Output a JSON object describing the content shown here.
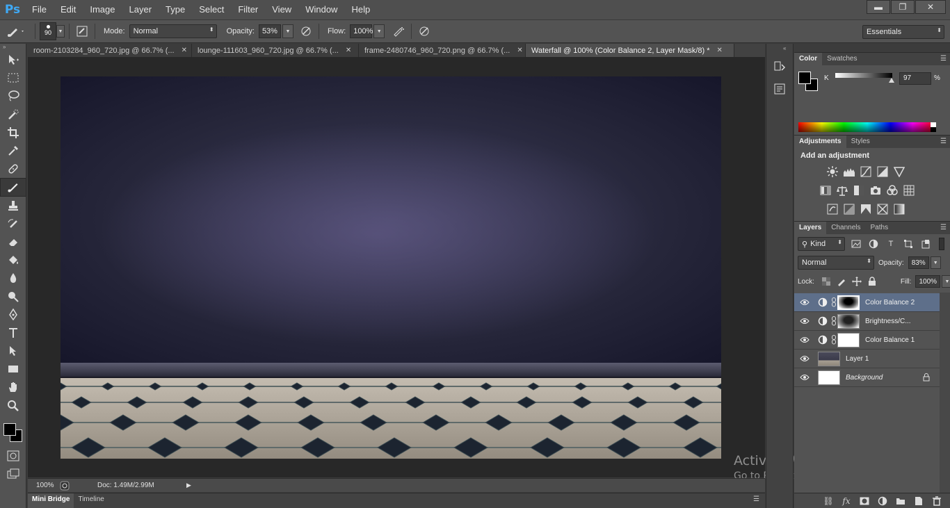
{
  "app": {
    "logo": "Ps"
  },
  "menu": [
    "File",
    "Edit",
    "Image",
    "Layer",
    "Type",
    "Select",
    "Filter",
    "View",
    "Window",
    "Help"
  ],
  "window_controls": {
    "minimize": "▬",
    "restore": "❐",
    "close": "✕"
  },
  "options": {
    "brush_size": "90",
    "mode_label": "Mode:",
    "mode_value": "Normal",
    "opacity_label": "Opacity:",
    "opacity_value": "53%",
    "flow_label": "Flow:",
    "flow_value": "100%",
    "workspace": "Essentials"
  },
  "tabs": [
    {
      "label": "room-2103284_960_720.jpg @ 66.7% (...",
      "active": false
    },
    {
      "label": "lounge-111603_960_720.jpg @ 66.7% (...",
      "active": false
    },
    {
      "label": "frame-2480746_960_720.png @ 66.7% (...",
      "active": false
    },
    {
      "label": "Waterfall @ 100% (Color Balance 2, Layer Mask/8) *",
      "active": true
    }
  ],
  "status": {
    "zoom": "100%",
    "doc": "Doc: 1.49M/2.99M"
  },
  "bottom_tabs": [
    "Mini Bridge",
    "Timeline"
  ],
  "watermark": {
    "line1": "Activate Windows",
    "line2": "Go to PC settings to activate Windows."
  },
  "color_panel": {
    "tabs": [
      "Color",
      "Swatches"
    ],
    "channel_label": "K",
    "channel_value": "97",
    "percent": "%",
    "k_level": 0.97
  },
  "adjustments_panel": {
    "tabs": [
      "Adjustments",
      "Styles"
    ],
    "title": "Add an adjustment"
  },
  "layers_panel": {
    "tabs": [
      "Layers",
      "Channels",
      "Paths"
    ],
    "kind": "Kind",
    "blend_mode": "Normal",
    "opacity_label": "Opacity:",
    "opacity_value": "83%",
    "lock_label": "Lock:",
    "fill_label": "Fill:",
    "fill_value": "100%",
    "layers": [
      {
        "name": "Color Balance 2",
        "type": "adjustment",
        "selected": true
      },
      {
        "name": "Brightness/C...",
        "type": "adjustment",
        "selected": false
      },
      {
        "name": "Color Balance 1",
        "type": "adjustment",
        "selected": false
      },
      {
        "name": "Layer 1",
        "type": "pixel",
        "selected": false
      },
      {
        "name": "Background",
        "type": "background",
        "selected": false
      }
    ]
  },
  "colors": {
    "accent": "#3fa9f5",
    "selection": "#5e6f8a",
    "panel": "#535353"
  }
}
